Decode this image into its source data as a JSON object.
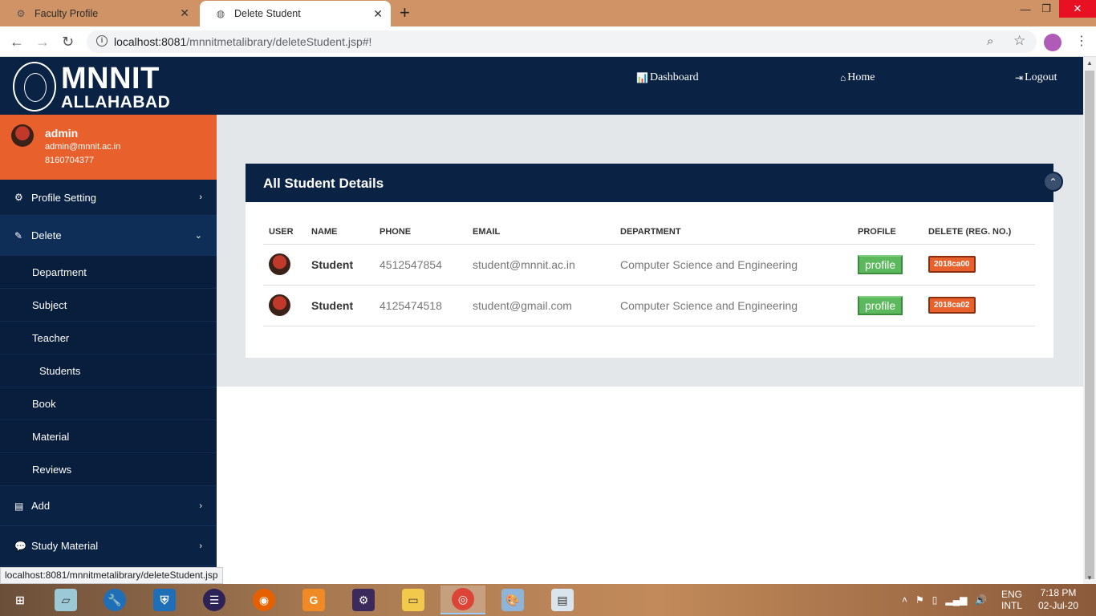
{
  "browser": {
    "tabs": [
      {
        "title": "Faculty Profile",
        "icon": "seal-icon"
      },
      {
        "title": "Delete Student",
        "icon": "globe-icon"
      }
    ],
    "url_host": "localhost:8081",
    "url_path": "/mnnitmetalibrary/deleteStudent.jsp#!",
    "status_url": "localhost:8081/mnnitmetalibrary/deleteStudent.jsp"
  },
  "header": {
    "logo_line1": "MNNIT",
    "logo_line2": "ALLAHABAD",
    "nav": {
      "dashboard": "Dashboard",
      "home": "Home",
      "logout": "Logout"
    }
  },
  "user": {
    "name": "admin",
    "email": "admin@mnnit.ac.in",
    "phone": "8160704377"
  },
  "sidebar": {
    "profile_setting": "Profile Setting",
    "delete": "Delete",
    "delete_items": [
      "Department",
      "Subject",
      "Teacher",
      "Students",
      "Book",
      "Material",
      "Reviews"
    ],
    "add": "Add",
    "study_material": "Study Material"
  },
  "panel": {
    "title": "All Student Details",
    "columns": [
      "USER",
      "NAME",
      "PHONE",
      "EMAIL",
      "DEPARTMENT",
      "PROFILE",
      "DELETE (REG. NO.)"
    ],
    "rows": [
      {
        "name": "Student",
        "phone": "4512547854",
        "email": "student@mnnit.ac.in",
        "department": "Computer Science and Engineering",
        "profile": "profile",
        "regno": "2018ca00"
      },
      {
        "name": "Student",
        "phone": "4125474518",
        "email": "student@gmail.com",
        "department": "Computer Science and Engineering",
        "profile": "profile",
        "regno": "2018ca02"
      }
    ]
  },
  "taskbar": {
    "lang1": "ENG",
    "lang2": "INTL",
    "time": "7:18 PM",
    "date": "02-Jul-20"
  },
  "colors": {
    "navy": "#0a2243",
    "orange": "#e8602c",
    "green": "#5cb85c"
  }
}
